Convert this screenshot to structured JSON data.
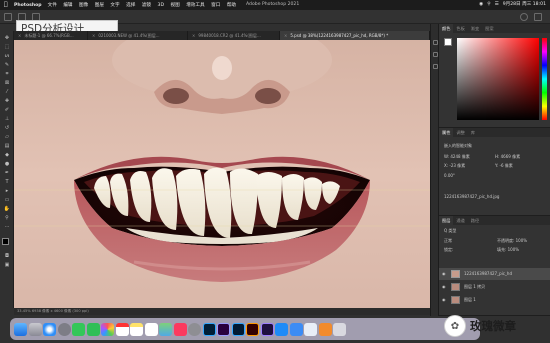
{
  "menubar": {
    "app_name": "Photoshop",
    "menus": [
      "文件",
      "编辑",
      "图像",
      "图层",
      "文字",
      "选择",
      "滤镜",
      "3D",
      "视图",
      "增效工具",
      "窗口",
      "帮助"
    ],
    "window_title": "Adobe Photoshop 2021",
    "clock": "9月28日 周三 18:01"
  },
  "overlay_label": "PSD分析设计",
  "document_tabs": [
    {
      "label": "未标题-1 @ 66.7%(RGB...",
      "active": false
    },
    {
      "label": "0210003.NEW @ 41.4%(图层...",
      "active": false
    },
    {
      "label": "99840018.CR2 @ 41.4%(图层...",
      "active": false
    },
    {
      "label": "5.psd @ 38%(1224163987427_pic_hd, RGB/8*) *",
      "active": true
    }
  ],
  "status_bar": "33.45%   6938 像素 x 4600 像素 (300 ppi)",
  "color_panel": {
    "tabs": [
      "颜色",
      "色板",
      "渐变",
      "图案"
    ],
    "hue_indicator": "red"
  },
  "properties_panel": {
    "tabs": [
      "属性",
      "调整",
      "库"
    ],
    "section": "嵌入的智能对象",
    "w_label": "W:",
    "w_value": "4248 像素",
    "h_label": "H:",
    "h_value": "4669 像素",
    "x_label": "X:",
    "x_value": "-23 像素",
    "y_label": "Y:",
    "y_value": "-6 像素",
    "angle": "0.00°",
    "filename": "1224163987427_pic_hd.jpg"
  },
  "layers_panel": {
    "tabs": [
      "图层",
      "通道",
      "路径"
    ],
    "filter_label": "Q 类型",
    "blend_mode": "正常",
    "opacity_label": "不透明度:",
    "opacity": "100%",
    "lock_label": "锁定:",
    "fill_label": "填充:",
    "fill": "100%",
    "layers": [
      {
        "name": "1224163987427_pic_hd",
        "selected": true
      },
      {
        "name": "图层 1 拷贝",
        "selected": false
      },
      {
        "name": "图层 1",
        "selected": false
      }
    ]
  },
  "dock": {
    "apps": [
      "finder",
      "launchpad",
      "safari",
      "system-prefs",
      "messages",
      "facetime",
      "photos",
      "calendar",
      "notes",
      "reminders",
      "maps",
      "music",
      "settings",
      "photoshop",
      "premiere",
      "lightroom",
      "illustrator",
      "premiere-rush",
      "appstore",
      "mail",
      "preview",
      "pages",
      "trash"
    ]
  },
  "brand_watermark": "玫瑰微章"
}
